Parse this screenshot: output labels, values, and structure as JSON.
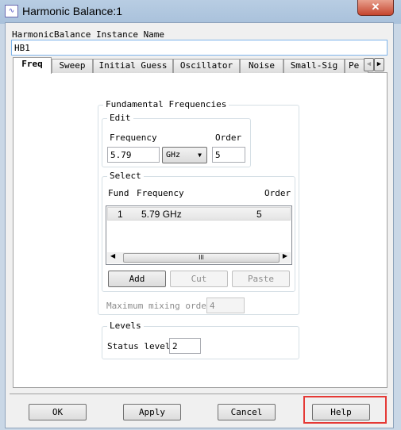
{
  "window": {
    "title": "Harmonic Balance:1",
    "app_icon": "waveform-icon",
    "close_label": "✕"
  },
  "instance": {
    "label": "HarmonicBalance Instance Name",
    "value": "HB1"
  },
  "tabs": [
    {
      "label": "Freq"
    },
    {
      "label": "Sweep"
    },
    {
      "label": "Initial Guess"
    },
    {
      "label": "Oscillator"
    },
    {
      "label": "Noise"
    },
    {
      "label": "Small-Sig"
    },
    {
      "label": "Pe"
    }
  ],
  "tab_scroll": {
    "left": "◀",
    "right": "▶"
  },
  "fundamental": {
    "title": "Fundamental Frequencies",
    "edit": {
      "title": "Edit",
      "freq_label": "Frequency",
      "order_label": "Order",
      "freq_value": "5.79",
      "unit": "GHz",
      "order_value": "5"
    },
    "select": {
      "title": "Select",
      "headers": [
        "Fund",
        "Frequency",
        "Order"
      ],
      "rows": [
        {
          "fund": "1",
          "frequency": "5.79 GHz",
          "order": "5"
        }
      ],
      "scroll_grip": "III"
    },
    "buttons": {
      "add": "Add",
      "cut": "Cut",
      "paste": "Paste"
    },
    "max_mixing_label": "Maximum mixing order",
    "max_mixing_value": "4"
  },
  "levels": {
    "title": "Levels",
    "status_label": "Status level",
    "status_value": "2"
  },
  "footer": {
    "ok": "OK",
    "apply": "Apply",
    "cancel": "Cancel",
    "help": "Help"
  },
  "colors": {
    "highlight": "#e53935"
  }
}
